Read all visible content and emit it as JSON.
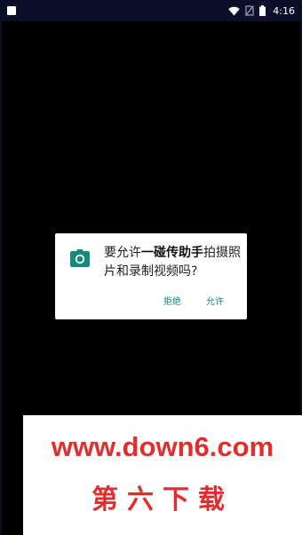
{
  "status_bar": {
    "time": "4:16",
    "icons": [
      "notification-square-icon",
      "wifi-icon",
      "no-sim-icon",
      "battery-icon"
    ]
  },
  "dialog": {
    "icon": "camera-icon",
    "message_prefix": "要允许",
    "app_name": "一碰传助手",
    "message_suffix": "拍摄照片和录制视频吗?",
    "deny_label": "拒绝",
    "allow_label": "允许",
    "accent_color": "#16897d"
  },
  "watermark": {
    "url": "www.down6.com",
    "brand": "第六下载",
    "color": "#e02e2e"
  }
}
